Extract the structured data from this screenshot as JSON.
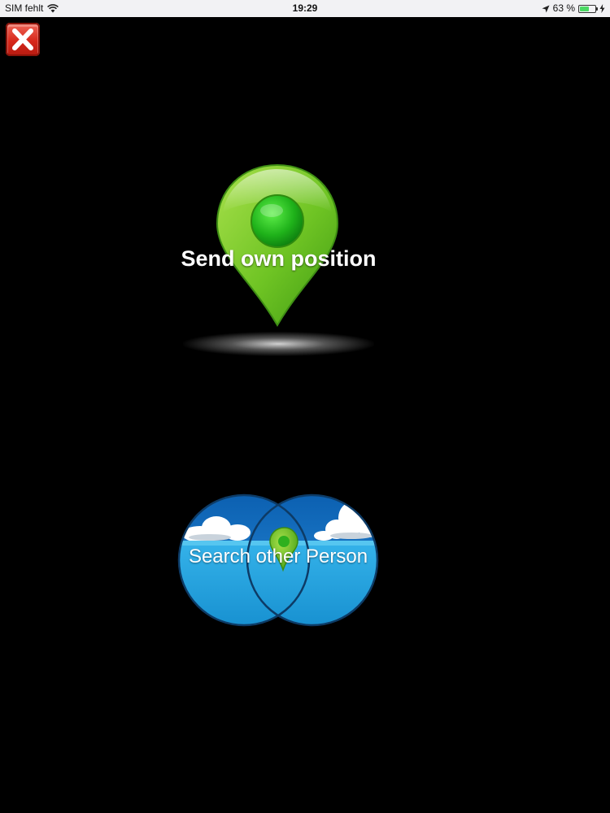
{
  "status_bar": {
    "carrier": "SIM fehlt",
    "time": "19:29",
    "battery_percent": "63 %",
    "battery_level": 0.63
  },
  "icons": {
    "close": "close-icon",
    "pin": "location-pin-icon",
    "binoculars": "binoculars-icon"
  },
  "colors": {
    "background": "#000000",
    "pin_green": "#7ccd2a",
    "binocular_blue": "#1e9bdb",
    "close_red": "#d7281b"
  },
  "actions": {
    "send_position_label": "Send own position",
    "search_person_label": "Search other Person"
  }
}
